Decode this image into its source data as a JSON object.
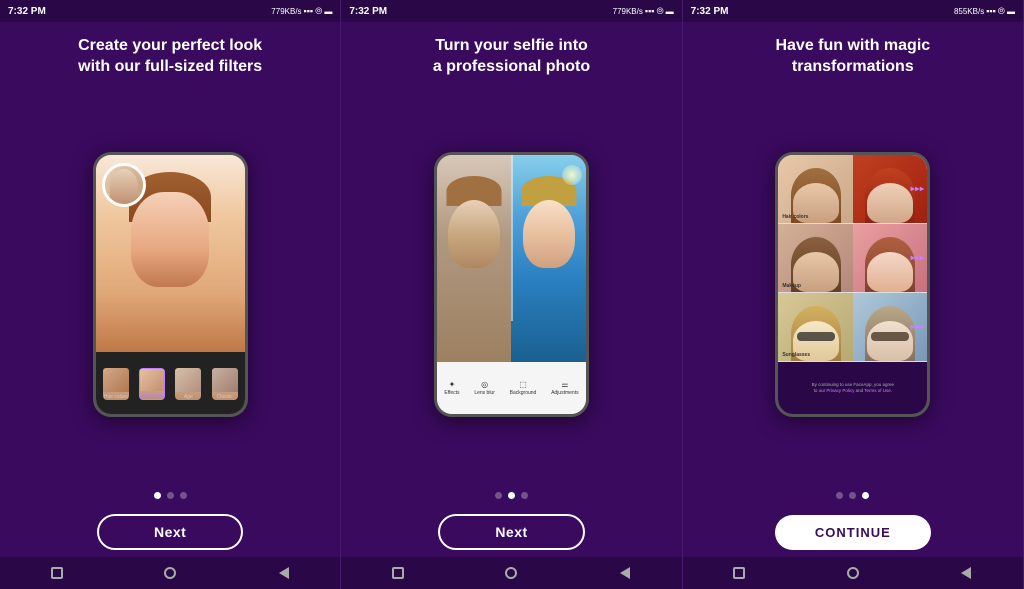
{
  "panels": [
    {
      "id": "panel-1",
      "statusBar": {
        "time": "7:32 PM",
        "network": "779KB/s",
        "signal": "▪▪▪",
        "wifi": "📶",
        "battery": "🔋"
      },
      "heading": "Create your perfect look\nwith our full-sized filters",
      "phoneContent": "face-filters",
      "dots": [
        "active",
        "inactive",
        "inactive"
      ],
      "button": {
        "type": "next",
        "label": "Next"
      },
      "navBar": true
    },
    {
      "id": "panel-2",
      "statusBar": {
        "time": "7:32 PM",
        "network": "779KB/s",
        "signal": "▪▪▪",
        "wifi": "📶",
        "battery": "🔋"
      },
      "heading": "Turn your selfie into\na professional photo",
      "phoneContent": "selfie-pro",
      "dots": [
        "inactive",
        "active",
        "inactive"
      ],
      "button": {
        "type": "next",
        "label": "Next"
      },
      "navBar": true
    },
    {
      "id": "panel-3",
      "statusBar": {
        "time": "7:32 PM",
        "network": "855KB/s",
        "signal": "▪▪▪",
        "wifi": "📶",
        "battery": "🔋"
      },
      "heading": "Have fun with magic\ntransformations",
      "phoneContent": "transformations",
      "dots": [
        "inactive",
        "inactive",
        "active"
      ],
      "button": {
        "type": "continue",
        "label": "CONTINUE"
      },
      "legalText": "By continuing to use FaceApp, you agree to our Privacy Policy and Terms of Use.",
      "privacyLabel": "Privacy Policy",
      "termsLabel": "Terms of Use",
      "navBar": true
    }
  ],
  "navIcons": {
    "square": "□",
    "circle": "○",
    "triangle": "◄"
  },
  "categories": {
    "hairColors": "Hair colors",
    "makeup": "Makeup",
    "sunglasses": "Sunglasses"
  },
  "phoneTools": {
    "effects": "Effects",
    "lensBlur": "Lens blur",
    "background": "Background",
    "adjustments": "Adjustments"
  }
}
